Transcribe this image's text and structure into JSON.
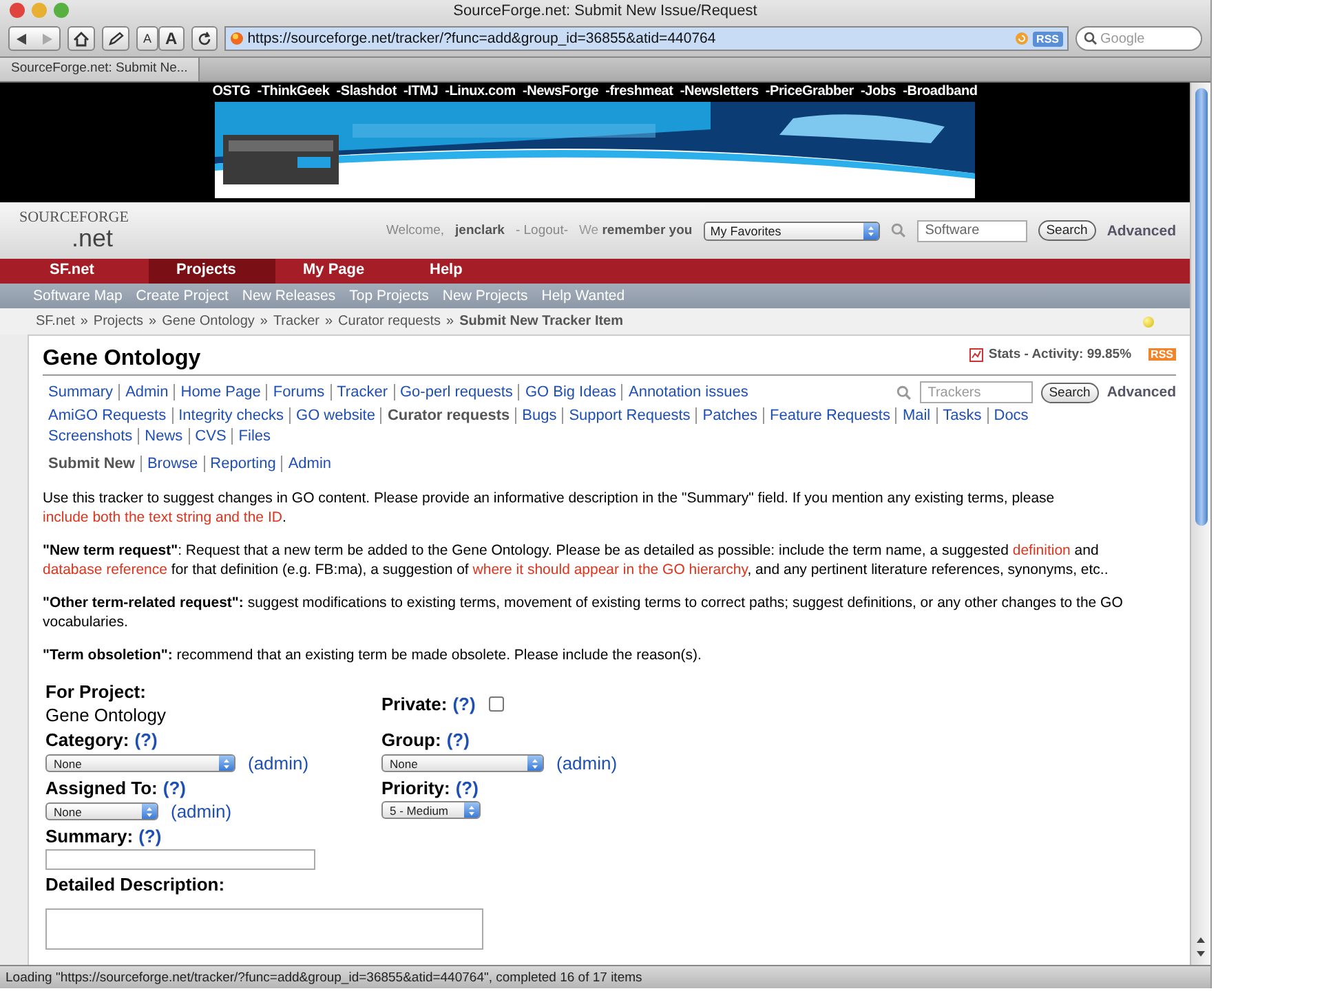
{
  "window": {
    "title": "SourceForge.net: Submit New Issue/Request"
  },
  "toolbar": {
    "text_smaller": "A",
    "text_larger": "A",
    "address": "https://sourceforge.net/tracker/?func=add&group_id=36855&atid=440764",
    "rss": "RSS",
    "search_placeholder": "Google"
  },
  "tabs": [
    {
      "label": "SourceForge.net: Submit Ne...",
      "selected": true
    }
  ],
  "network_bar": {
    "brand": "OSTG",
    "links": [
      "-ThinkGeek",
      "-Slashdot",
      "-ITMJ",
      "-Linux.com",
      "-NewsForge",
      "-freshmeat",
      "-Newsletters",
      "-PriceGrabber",
      "-Jobs",
      "-Broadband"
    ]
  },
  "banner": {
    "kind": "picture"
  },
  "header": {
    "logo_top": "SOURCEFORGE",
    "logo_bottom": ".net",
    "welcome": "Welcome,",
    "user": "jenclark",
    "logout": "- Logout-",
    "remember": "We **remember you**",
    "favorites": "My Favorites",
    "search_value": "Software",
    "search_button": "Search",
    "advanced": "Advanced"
  },
  "main_nav": [
    {
      "label": "SF.net",
      "selected": false
    },
    {
      "label": "Projects",
      "selected": true
    },
    {
      "label": "My Page",
      "selected": false
    },
    {
      "label": "Help",
      "selected": false
    }
  ],
  "sub_nav": [
    "Software Map",
    "Create Project",
    "New Releases",
    "Top Projects",
    "New Projects",
    "Help Wanted"
  ],
  "breadcrumb": {
    "separator": "»",
    "items": [
      "SF.net",
      "Projects",
      "Gene Ontology",
      "Tracker",
      "Curator requests",
      "Submit New Tracker Item"
    ]
  },
  "project": {
    "title": "Gene Ontology",
    "stats": "Stats - Activity: 99.85%",
    "rss": "RSS"
  },
  "project_nav": [
    [
      {
        "label": "Summary",
        "selected": false
      },
      {
        "label": "Admin",
        "selected": false
      },
      {
        "label": "Home Page",
        "selected": false
      },
      {
        "label": "Forums",
        "selected": false
      },
      {
        "label": "Tracker",
        "selected": false
      },
      {
        "label": "Go-perl requests",
        "selected": false
      },
      {
        "label": "GO Big Ideas",
        "selected": false
      },
      {
        "label": "Annotation issues",
        "selected": false
      }
    ],
    [
      {
        "label": "AmiGO Requests",
        "selected": false
      },
      {
        "label": "Integrity checks",
        "selected": false
      },
      {
        "label": "GO website",
        "selected": false
      },
      {
        "label": "Curator requests",
        "selected": true
      },
      {
        "label": "Bugs",
        "selected": false
      },
      {
        "label": "Support Requests",
        "selected": false
      },
      {
        "label": "Patches",
        "selected": false
      },
      {
        "label": "Feature Requests",
        "selected": false
      },
      {
        "label": "Mail",
        "selected": false
      },
      {
        "label": "Tasks",
        "selected": false
      },
      {
        "label": "Docs",
        "selected": false
      }
    ],
    [
      {
        "label": "Screenshots",
        "selected": false
      },
      {
        "label": "News",
        "selected": false
      },
      {
        "label": "CVS",
        "selected": false
      },
      {
        "label": "Files",
        "selected": false
      }
    ]
  ],
  "tracker_search": {
    "placeholder": "Trackers",
    "button": "Search",
    "advanced": "Advanced"
  },
  "tracker_nav": [
    {
      "label": "Submit New",
      "selected": true
    },
    {
      "label": "Browse",
      "selected": false
    },
    {
      "label": "Reporting",
      "selected": false
    },
    {
      "label": "Admin",
      "selected": false
    }
  ],
  "paragraphs": [
    [
      {
        "kind": "text",
        "text": "Use this tracker to suggest changes in GO content. Please provide an informative description in the \"Summary\" field. If you mention any existing terms, please "
      },
      {
        "kind": "link",
        "text": "include both the text string and the ID"
      },
      {
        "kind": "text",
        "text": "."
      }
    ],
    [
      {
        "kind": "bold",
        "text": "\"New term request\""
      },
      {
        "kind": "text",
        "text": ": Request that a new term be added to the Gene Ontology. Please be as detailed as possible: include the term name, a suggested "
      },
      {
        "kind": "link",
        "text": "definition"
      },
      {
        "kind": "text",
        "text": " and "
      },
      {
        "kind": "link",
        "text": "database reference"
      },
      {
        "kind": "text",
        "text": " for that definition (e.g. FB:ma), a suggestion of "
      },
      {
        "kind": "link",
        "text": "where it should appear in the GO hierarchy"
      },
      {
        "kind": "text",
        "text": ", and any pertinent literature references, synonyms, etc.."
      }
    ],
    [
      {
        "kind": "bold",
        "text": "\"Other term-related request\":"
      },
      {
        "kind": "text",
        "text": " suggest modifications to existing terms, movement of existing terms to correct paths; suggest definitions, or any other changes to the GO vocabularies."
      }
    ],
    [
      {
        "kind": "bold",
        "text": "\"Term obsoletion\":"
      },
      {
        "kind": "text",
        "text": " recommend that an existing term be made obsolete. Please include the reason(s)."
      }
    ]
  ],
  "form": {
    "rows": [
      [
        {
          "kind": "static",
          "label": "For Project:",
          "value": "Gene Ontology"
        },
        {
          "kind": "checkbox",
          "label": "Private:",
          "help": "(?)",
          "checked": false
        }
      ],
      [
        {
          "kind": "select",
          "label": "Category:",
          "help": "(?)",
          "value": "None",
          "admin": "(admin)"
        },
        {
          "kind": "select",
          "label": "Group:",
          "help": "(?)",
          "value": "None",
          "admin": "(admin)"
        }
      ],
      [
        {
          "kind": "select",
          "label": "Assigned To:",
          "help": "(?)",
          "value": "None",
          "admin": "(admin)"
        },
        {
          "kind": "select",
          "label": "Priority:",
          "help": "(?)",
          "value": "5 - Medium"
        }
      ],
      [
        {
          "kind": "input",
          "label": "Summary:",
          "help": "(?)"
        }
      ],
      [
        {
          "kind": "textarea",
          "label": "Detailed Description:"
        }
      ]
    ]
  },
  "status_bar": "Loading \"https://sourceforge.net/tracker/?func=add&group_id=36855&atid=440764\", completed 16 of 17 items"
}
